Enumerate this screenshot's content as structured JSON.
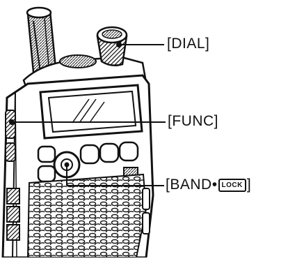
{
  "callouts": {
    "dial": "[DIAL]",
    "func": "[FUNC]",
    "band_prefix": "[BAND",
    "band_dot": "•",
    "band_key": "LOCK",
    "band_suffix": "]"
  }
}
